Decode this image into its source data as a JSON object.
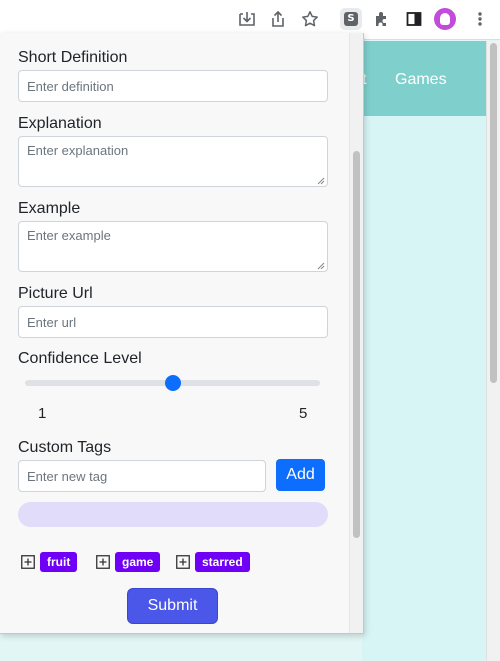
{
  "browser": {
    "icons": [
      "install-icon",
      "share-icon",
      "star-icon",
      "extension-s-icon",
      "puzzle-icon",
      "side-panel-icon",
      "avatar",
      "kebab-menu-icon"
    ],
    "extension_letter": "S"
  },
  "site": {
    "nav_partial": "t",
    "nav_games": "Games"
  },
  "form": {
    "short_definition": {
      "label": "Short Definition",
      "placeholder": "Enter definition",
      "value": ""
    },
    "explanation": {
      "label": "Explanation",
      "placeholder": "Enter explanation",
      "value": ""
    },
    "example": {
      "label": "Example",
      "placeholder": "Enter example",
      "value": ""
    },
    "picture_url": {
      "label": "Picture Url",
      "placeholder": "Enter url",
      "value": ""
    },
    "confidence": {
      "label": "Confidence Level",
      "min": "1",
      "max": "5",
      "value": 3
    },
    "custom_tags": {
      "label": "Custom Tags",
      "placeholder": "Enter new tag",
      "add_label": "Add"
    },
    "tags": [
      {
        "label": "fruit"
      },
      {
        "label": "game"
      },
      {
        "label": "starred"
      }
    ],
    "submit_label": "Submit"
  },
  "colors": {
    "primary": "#0d6efd",
    "tag": "#6f00f5",
    "submit": "#4b57e8",
    "site_nav": "#7fcfcc",
    "site_bg": "#d6f5f4"
  }
}
